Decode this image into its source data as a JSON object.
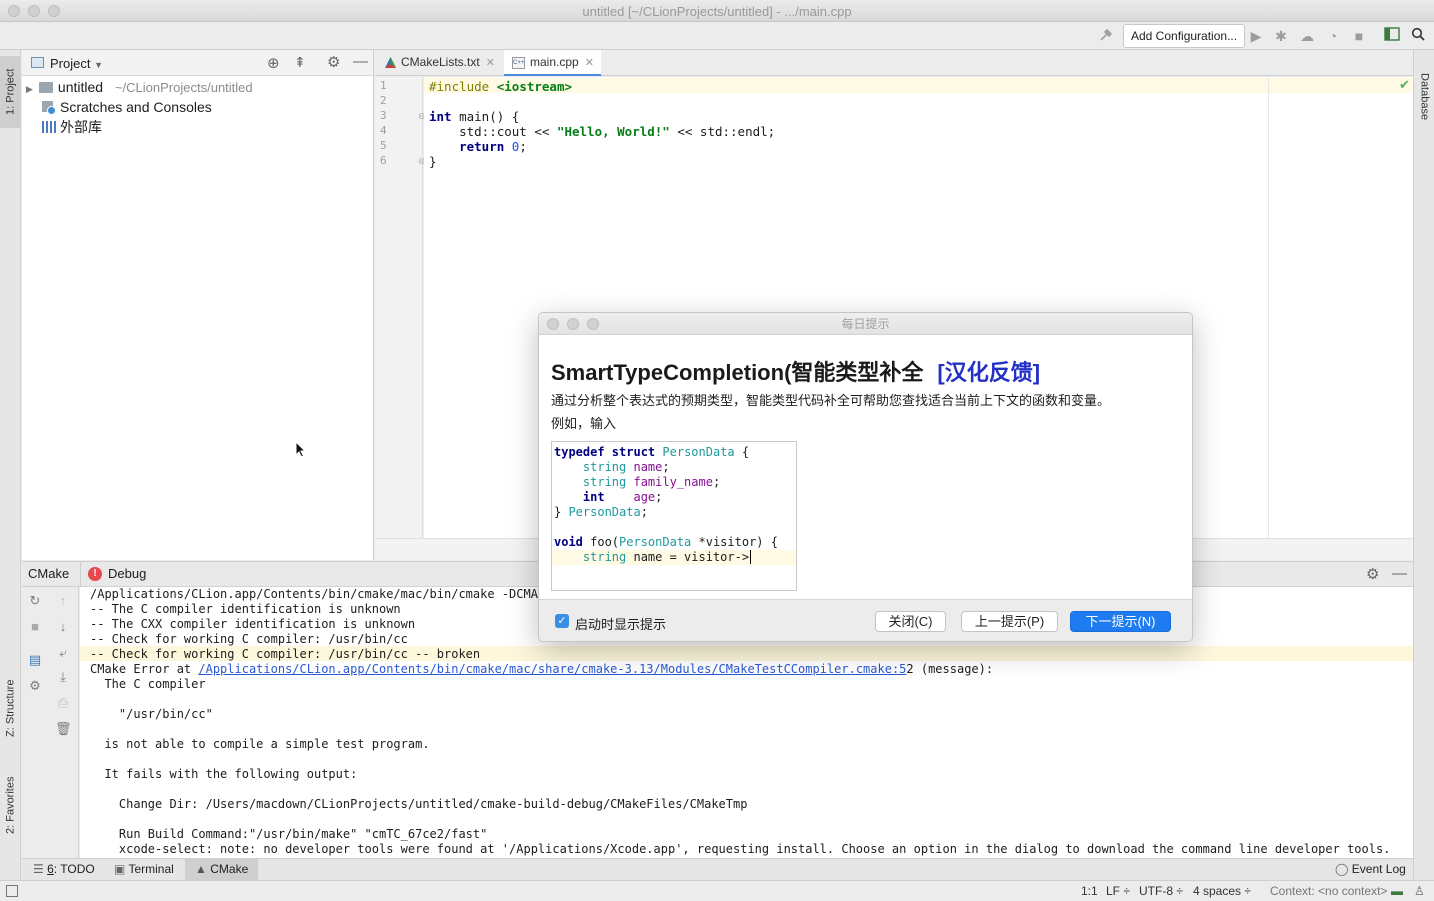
{
  "window": {
    "title": "untitled [~/CLionProjects/untitled] - .../main.cpp"
  },
  "toolbar": {
    "add_configuration": "Add Configuration..."
  },
  "left_stripe": {
    "project_tab": "1: Project",
    "structure_tab": "Z: Structure",
    "favorites_tab": "2: Favorites"
  },
  "right_stripe": {
    "database_tab": "Database"
  },
  "project_panel": {
    "title": "Project",
    "items": [
      {
        "label": "untitled",
        "path": "~/CLionProjects/untitled"
      },
      {
        "label": "Scratches and Consoles"
      },
      {
        "label": "外部库"
      }
    ]
  },
  "editor": {
    "tabs": [
      {
        "label": "CMakeLists.txt"
      },
      {
        "label": "main.cpp"
      }
    ],
    "line_numbers": [
      "1",
      "2",
      "3",
      "4",
      "5",
      "6"
    ],
    "code": {
      "l1_directive": "#include",
      "l1_header": "<iostream>",
      "l3_kw": "int",
      "l3_rest": " main() {",
      "l4_a": "    std::cout << ",
      "l4_str": "\"Hello, World!\"",
      "l4_b": " << std::endl;",
      "l5_kw": "    return ",
      "l5_num": "0",
      "l5_end": ";",
      "l6": "}"
    }
  },
  "bottom_panel": {
    "tabs": [
      {
        "label": "CMake"
      },
      {
        "label": "Debug"
      }
    ],
    "console_lines": [
      "/Applications/CLion.app/Contents/bin/cmake/mac/bin/cmake -DCMAKE",
      "-- The C compiler identification is unknown",
      "-- The CXX compiler identification is unknown",
      "-- Check for working C compiler: /usr/bin/cc",
      "-- Check for working C compiler: /usr/bin/cc -- broken",
      "",
      "  The C compiler",
      "",
      "    \"/usr/bin/cc\"",
      "",
      "  is not able to compile a simple test program.",
      "",
      "  It fails with the following output:",
      "",
      "    Change Dir: /Users/macdown/CLionProjects/untitled/cmake-build-debug/CMakeFiles/CMakeTmp",
      "",
      "    Run Build Command:\"/usr/bin/make\" \"cmTC_67ce2/fast\"",
      "    xcode-select: note: no developer tools were found at '/Applications/Xcode.app', requesting install. Choose an option in the dialog to download the command line developer tools."
    ],
    "error_prefix": "CMake Error at ",
    "error_link": "/Applications/CLion.app/Contents/bin/cmake/mac/share/cmake-3.13/Modules/CMakeTestCCompiler.cmake:5",
    "error_suffix": "2 (message):"
  },
  "bottom_bar": {
    "todo_num": "6",
    "todo": ": TODO",
    "terminal": "Terminal",
    "cmake": "CMake",
    "event_log": "Event Log"
  },
  "status_bar": {
    "position": "1:1",
    "line_sep": "LF ÷",
    "encoding": "UTF-8 ÷",
    "indent": "4 spaces ÷",
    "context": "Context: <no context>"
  },
  "dialog": {
    "title": "每日提示",
    "heading": "SmartTypeCompletion(智能类型补全",
    "feedback": "[汉化反馈]",
    "description": "通过分析整个表达式的预期类型，智能类型代码补全可帮助您查找适合当前上下文的函数和变量。",
    "example_label": "例如，输入",
    "sample": {
      "l1_kw": "typedef struct",
      "l1_type": "PersonData",
      "l1_end": " {",
      "l2_type": "    string",
      "l2_field": "name",
      "l3_type": "    string",
      "l3_field": "family_name",
      "l4_kw": "    int",
      "l4_field": "age",
      "l5_a": "} ",
      "l5_type": "PersonData",
      "l5_end": ";",
      "l7_kw": "void",
      "l7_a": " foo(",
      "l7_type": "PersonData",
      "l7_b": " *visitor) {",
      "l8_type": "    string",
      "l8_rest": " name = visitor->"
    },
    "show_on_startup": "启动时显示提示",
    "show_on_startup_checked": true,
    "close_button": "关闭(C)",
    "prev_button": "上一提示(P)",
    "next_button": "下一提示(N)"
  },
  "colors": {
    "accent": "#1f7cf0",
    "keyword": "#000080",
    "string": "#067d17",
    "link": "#2a58d4",
    "error_icon": "#e5484d"
  }
}
